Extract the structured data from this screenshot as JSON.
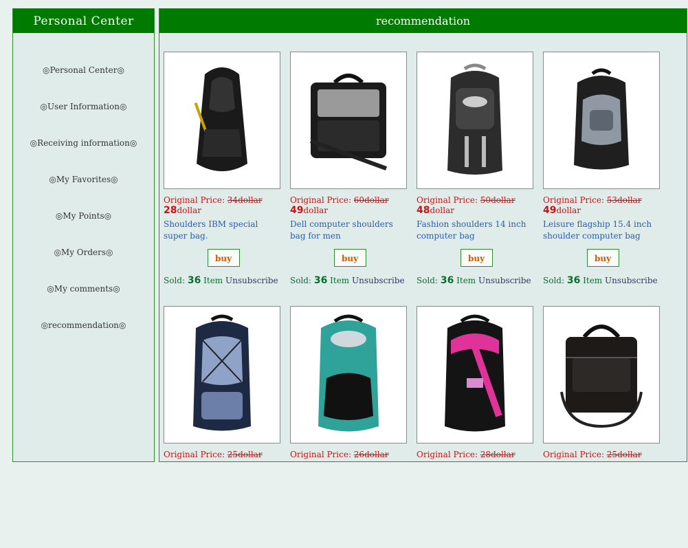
{
  "sidebar": {
    "title": "Personal Center",
    "items": [
      {
        "label": "◎Personal Center◎"
      },
      {
        "label": "◎User Information◎"
      },
      {
        "label": "◎Receiving information◎"
      },
      {
        "label": "◎My Favorites◎"
      },
      {
        "label": "◎My Points◎"
      },
      {
        "label": "◎My Orders◎"
      },
      {
        "label": "◎My comments◎"
      },
      {
        "label": "◎recommendation◎"
      }
    ]
  },
  "main": {
    "title": "recommendation",
    "labels": {
      "original_price": "Original Price: ",
      "buy": "buy",
      "sold": "Sold: ",
      "item": "Item",
      "unsubscribe": "Unsubscribe"
    },
    "products": [
      {
        "orig": "34dollar",
        "price": "28",
        "unit": "dollar",
        "name": "Shoulders IBM special super bag.",
        "sold": "36"
      },
      {
        "orig": "60dollar",
        "price": "49",
        "unit": "dollar",
        "name": "Dell computer shoulders bag for men",
        "sold": "36"
      },
      {
        "orig": "50dollar",
        "price": "48",
        "unit": "dollar",
        "name": "Fashion shoulders 14 inch computer bag",
        "sold": "36"
      },
      {
        "orig": "53dollar",
        "price": "49",
        "unit": "dollar",
        "name": "Leisure flagship 15.4 inch shoulder computer bag",
        "sold": "36"
      },
      {
        "orig": "25dollar",
        "price": "",
        "unit": "",
        "name": "",
        "sold": ""
      },
      {
        "orig": "26dollar",
        "price": "",
        "unit": "",
        "name": "",
        "sold": ""
      },
      {
        "orig": "28dollar",
        "price": "",
        "unit": "",
        "name": "",
        "sold": ""
      },
      {
        "orig": "25dollar",
        "price": "",
        "unit": "",
        "name": "",
        "sold": ""
      }
    ]
  }
}
